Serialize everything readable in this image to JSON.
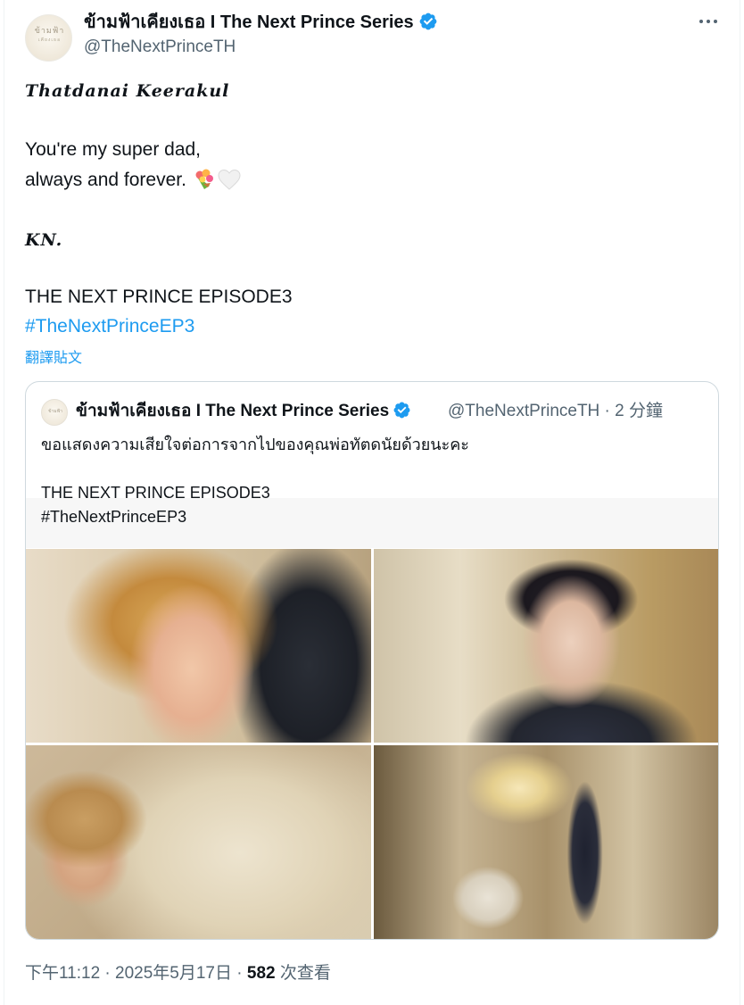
{
  "author": {
    "display_name": "ข้ามฟ้าเคียงเธอ I The Next Prince Series",
    "handle": "@TheNextPrinceTH",
    "avatar_text": "ข้ามฟ้า",
    "avatar_subtext": "เคียงเธอ",
    "verified_color": "#1d9bf0"
  },
  "more_button_icon": "more-horizontal-icon",
  "post": {
    "lines": [
      "Thatdanai Keerakul",
      "You're my super dad,",
      "always and forever.",
      "KN.",
      "THE NEXT PRINCE EPISODE3"
    ],
    "emojis": [
      "bouquet-icon",
      "white-heart-icon"
    ],
    "hashtag": "#TheNextPrinceEP3",
    "translate_label": "翻譯貼文"
  },
  "quote": {
    "display_name": "ข้ามฟ้าเคียงเธอ I The Next Prince Series",
    "handle_time": "@TheNextPrinceTH · 2 分鐘",
    "lines": [
      "ขอแสดงความเสียใจต่อการจากไปของคุณพ่อทัตดนัยด้วยนะคะ",
      "THE NEXT PRINCE EPISODE3",
      "#TheNextPrinceEP3"
    ],
    "photo_count": 4
  },
  "footer": {
    "time_date": "下午11:12 · 2025年5月17日 · ",
    "views_count": "582",
    "views_label": " 次查看"
  },
  "colors": {
    "accent": "#1d9bf0",
    "text": "#0f1419",
    "secondary": "#536471",
    "border": "#cfd9de"
  }
}
